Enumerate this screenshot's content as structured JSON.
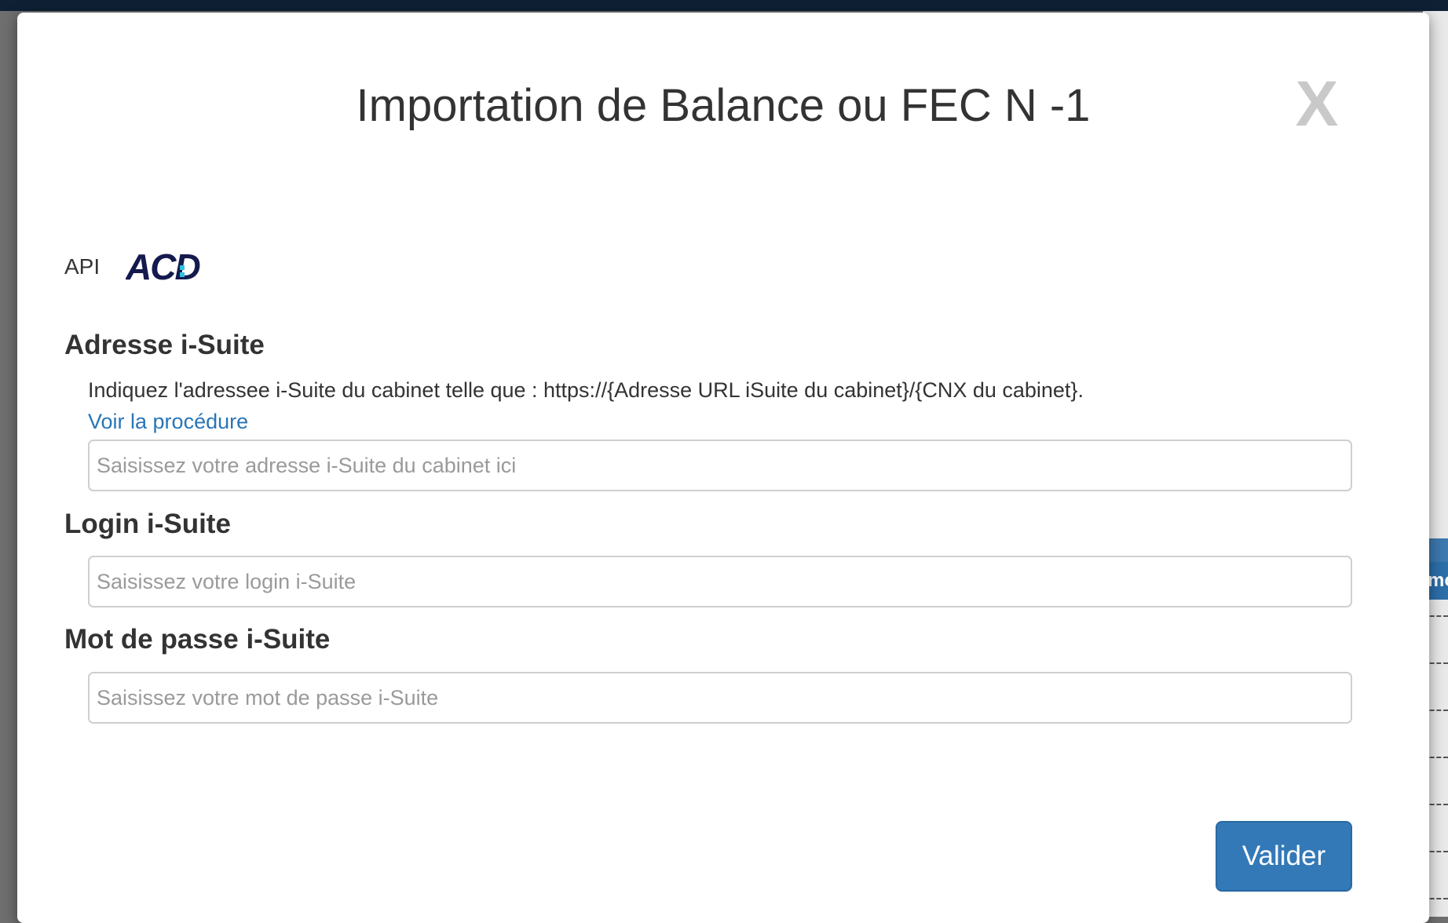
{
  "modal": {
    "title": "Importation de Balance ou FEC N -1",
    "close_label": "X"
  },
  "api": {
    "label": "API",
    "logo_text": "ACD"
  },
  "address": {
    "label": "Adresse i-Suite",
    "help": "Indiquez l'adressee i-Suite du cabinet telle que : https://{Adresse URL iSuite du cabinet}/{CNX du cabinet}.",
    "link_text": "Voir la procédure",
    "placeholder": "Saisissez votre adresse i-Suite du cabinet ici",
    "value": ""
  },
  "login": {
    "label": "Login i-Suite",
    "placeholder": "Saisissez votre login i-Suite",
    "value": ""
  },
  "password": {
    "label": "Mot de passe i-Suite",
    "placeholder": "Saisissez votre mot de passe i-Suite",
    "value": ""
  },
  "submit": {
    "label": "Valider"
  },
  "background": {
    "peek_text": "mo"
  },
  "colors": {
    "primary": "#3379b7",
    "link": "#2a75b6",
    "close": "#c9c9c9",
    "logo_navy": "#141a4e",
    "logo_accent": "#2ec1e0"
  }
}
